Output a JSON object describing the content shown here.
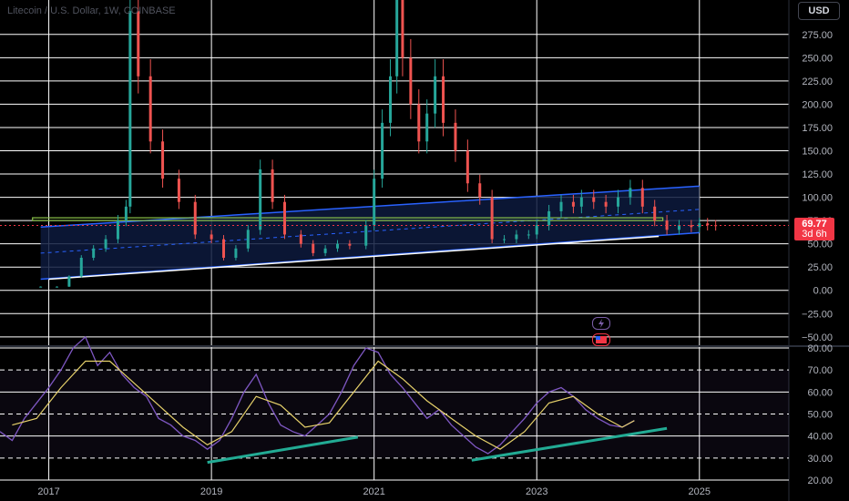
{
  "header": {
    "title": "Litecoin / U.S. Dollar, 1W, COINBASE",
    "currency_button": "USD"
  },
  "price_tag": {
    "price": "69.77",
    "countdown": "3d 6h"
  },
  "icons": {
    "indicator_1": "lightning-icon",
    "indicator_2": "flag-icon"
  },
  "colors": {
    "background": "#000000",
    "grid": "#ffffff",
    "candle_up": "#26a69a",
    "candle_down": "#ef5350",
    "channel": "#2962ff",
    "channel_fill": "#0d1a3d",
    "rsi": "#7e57c2",
    "rsi_ma": "#e6d16a",
    "divergence": "#22ab94",
    "price_line": "#f23645"
  },
  "chart_data": [
    {
      "type": "candlestick",
      "title": "Litecoin / U.S. Dollar, 1W, COINBASE",
      "x_ticks": [
        "2017",
        "2019",
        "2021",
        "2023",
        "2025"
      ],
      "y_ticks": [
        "275.00",
        "250.00",
        "225.00",
        "200.00",
        "175.00",
        "150.00",
        "125.00",
        "100.00",
        "75.00",
        "50.00",
        "25.00",
        "0.00",
        "−25.00",
        "−50.00"
      ],
      "ylim": [
        -58,
        312
      ],
      "xlim": [
        2016.4,
        2026.1
      ],
      "last_price": 69.77,
      "series": [
        {
          "name": "",
          "x": [
            2016.65,
            2016.9,
            2017.1,
            2017.25,
            2017.4,
            2017.55,
            2017.7,
            2017.85,
            2017.95,
            2018.0,
            2018.1,
            2018.25,
            2018.4,
            2018.6,
            2018.8,
            2019.0,
            2019.15,
            2019.3,
            2019.45,
            2019.6,
            2019.75,
            2019.9,
            2020.1,
            2020.25,
            2020.4,
            2020.55,
            2020.7,
            2020.9,
            2021.0,
            2021.1,
            2021.2,
            2021.28,
            2021.35,
            2021.45,
            2021.55,
            2021.65,
            2021.75,
            2021.85,
            2022.0,
            2022.15,
            2022.3,
            2022.45,
            2022.6,
            2022.75,
            2022.9,
            2023.0,
            2023.15,
            2023.3,
            2023.45,
            2023.55,
            2023.7,
            2023.85,
            2024.0,
            2024.15,
            2024.3,
            2024.45,
            2024.6,
            2024.75,
            2024.9,
            2025.0,
            2025.1,
            2025.2
          ],
          "values": [
            4,
            4,
            4,
            15,
            35,
            45,
            55,
            75,
            90,
            300,
            230,
            160,
            120,
            95,
            60,
            55,
            35,
            45,
            65,
            130,
            95,
            60,
            50,
            40,
            45,
            50,
            48,
            70,
            120,
            180,
            230,
            330,
            250,
            200,
            160,
            190,
            230,
            180,
            150,
            115,
            100,
            55,
            55,
            60,
            60,
            70,
            85,
            95,
            90,
            100,
            95,
            90,
            100,
            110,
            90,
            75,
            65,
            70,
            68,
            72,
            70,
            69.77
          ]
        }
      ],
      "hlines": [
        75,
        78
      ]
    },
    {
      "type": "line",
      "title": "",
      "y_ticks": [
        "80.00",
        "70.00",
        "60.00",
        "50.00",
        "40.00",
        "30.00",
        "20.00"
      ],
      "ylim": [
        20,
        80
      ],
      "series": [
        {
          "name": "",
          "x": [
            2016.4,
            2016.55,
            2016.7,
            2016.85,
            2017.0,
            2017.15,
            2017.3,
            2017.45,
            2017.6,
            2017.75,
            2017.9,
            2018.05,
            2018.2,
            2018.35,
            2018.5,
            2018.65,
            2018.8,
            2018.95,
            2019.1,
            2019.25,
            2019.4,
            2019.55,
            2019.7,
            2019.85,
            2020.0,
            2020.15,
            2020.3,
            2020.45,
            2020.6,
            2020.75,
            2020.9,
            2021.05,
            2021.2,
            2021.35,
            2021.5,
            2021.65,
            2021.8,
            2021.95,
            2022.1,
            2022.25,
            2022.4,
            2022.55,
            2022.7,
            2022.85,
            2023.0,
            2023.15,
            2023.3,
            2023.45,
            2023.6,
            2023.75,
            2023.9,
            2024.05,
            2024.2
          ],
          "values": [
            42,
            38,
            48,
            55,
            62,
            70,
            80,
            85,
            72,
            78,
            68,
            62,
            58,
            48,
            45,
            40,
            38,
            34,
            38,
            48,
            60,
            68,
            55,
            45,
            42,
            40,
            45,
            50,
            60,
            72,
            80,
            78,
            68,
            62,
            55,
            48,
            52,
            45,
            40,
            35,
            32,
            36,
            42,
            48,
            55,
            60,
            62,
            58,
            52,
            48,
            45,
            44,
            47
          ]
        },
        {
          "name": "",
          "x": [
            2016.55,
            2016.85,
            2017.15,
            2017.45,
            2017.75,
            2018.05,
            2018.35,
            2018.65,
            2018.95,
            2019.25,
            2019.55,
            2019.85,
            2020.15,
            2020.45,
            2020.75,
            2021.05,
            2021.35,
            2021.65,
            2021.95,
            2022.25,
            2022.55,
            2022.85,
            2023.15,
            2023.45,
            2023.75,
            2024.05,
            2024.2
          ],
          "values": [
            45,
            48,
            62,
            74,
            74,
            64,
            54,
            44,
            36,
            42,
            58,
            54,
            44,
            46,
            60,
            74,
            66,
            56,
            48,
            40,
            34,
            42,
            55,
            58,
            50,
            44,
            47
          ]
        }
      ]
    }
  ]
}
